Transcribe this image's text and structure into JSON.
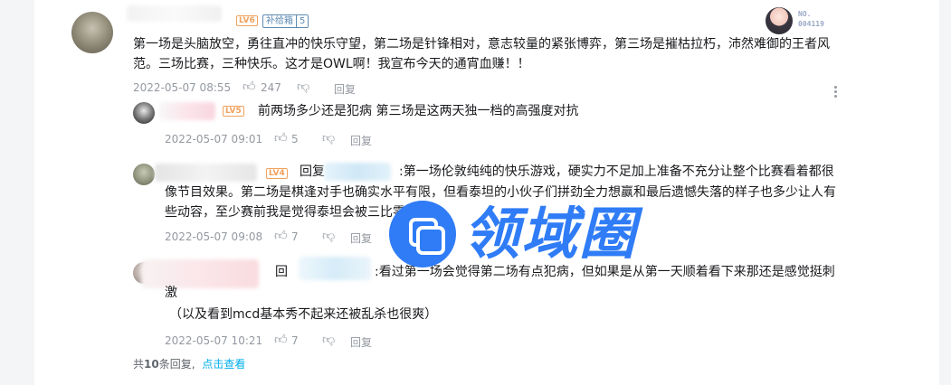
{
  "main_comment": {
    "badge_lv": "LV6",
    "fan_badge": "补给箱",
    "fan_level": "5",
    "nft_no_label": "NO.",
    "nft_no_value": "004119",
    "text_line1": "第一场是头脑放空，勇往直冲的快乐守望，第二场是针锋相对，意志较量的紧张博弈，第三场是摧枯拉朽，沛然难御的王者风",
    "text_line2": "范。三场比赛，三种快乐。这才是OWL啊！我宣布今天的通宵血赚！！",
    "time": "2022-05-07 08:55",
    "likes": "247",
    "reply_label": "回复",
    "more_icon": "more-vertical-icon"
  },
  "replies": [
    {
      "badge_lv": "LV5",
      "text": "前两场多少还是犯病 第三场是这两天独一档的高强度对抗",
      "time": "2022-05-07 09:01",
      "likes": "5",
      "reply_label": "回复"
    },
    {
      "badge_lv": "LV4",
      "prefix": "回复",
      "text_line1": ":第一场伦敦纯纯的快乐游戏，硬实力不足加上准备不充分让整个比赛看着都很",
      "text_line2": "像节目效果。第二场是棋逢对手也确实水平有限，但看泰坦的小伙子们拼劲全力想赢和最后遗憾失落的样子也多少让人有",
      "text_line3": "些动容，至少赛前我是觉得泰坦会被三比零的走的",
      "time": "2022-05-07 09:08",
      "likes": "7",
      "reply_label": "回复"
    },
    {
      "prefix": "回",
      "text_line1": ":看过第一场会觉得第二场有点犯病，但如果是从第一天顺着看下来那还是感觉挺刺",
      "text_line2": "激",
      "text_line3": "（以及看到mcd基本秀不起来还被乱杀也很爽）",
      "time": "2022-05-07 10:21",
      "likes": "7",
      "reply_label": "回复"
    }
  ],
  "footer": {
    "total_prefix": "共",
    "total_count": "10",
    "total_suffix": "条回复,",
    "view_link": "点击查看"
  },
  "watermark": {
    "text": "领域圈"
  },
  "colors": {
    "accent_link": "#00aeec",
    "watermark_blue": "#2f7cf6",
    "level_orange": "#f0a15c",
    "muted": "#9499a0"
  }
}
